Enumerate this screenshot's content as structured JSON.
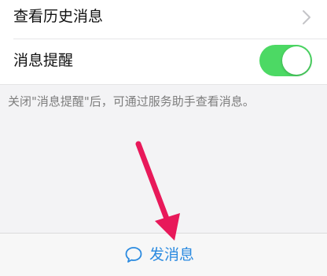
{
  "settings": {
    "history_label": "查看历史消息",
    "reminder_label": "消息提醒",
    "reminder_enabled": true
  },
  "hint": "关闭\"消息提醒\"后，可通过服务助手查看消息。",
  "bottom_bar": {
    "send_label": "发消息"
  },
  "colors": {
    "toggle_on": "#4cd964",
    "accent": "#2a8ae0",
    "annotation_arrow": "#e8195a"
  },
  "icons": {
    "history_row": "chevron-right-icon",
    "send_button": "chat-bubble-icon"
  }
}
